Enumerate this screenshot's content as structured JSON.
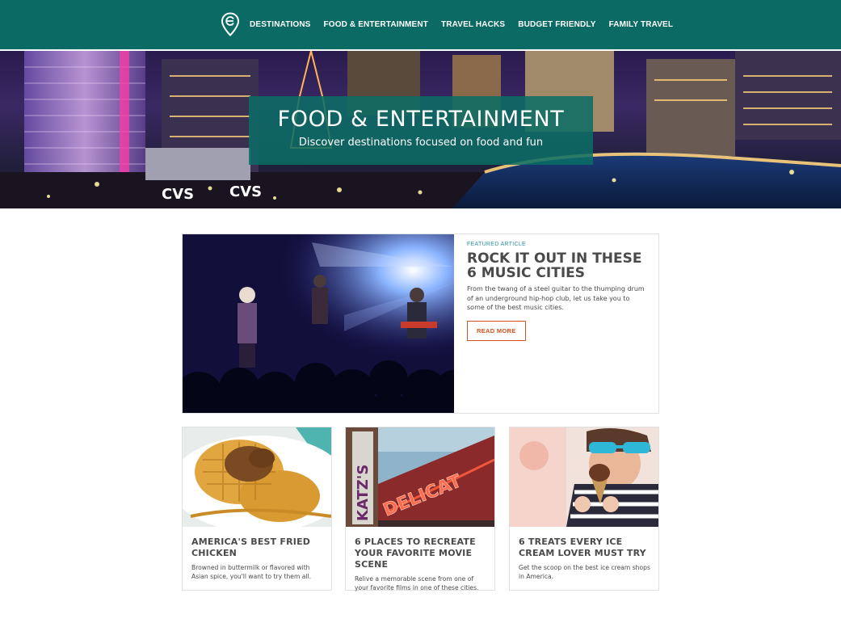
{
  "nav": {
    "logo_icon": "location-pin-icon",
    "links": [
      {
        "label": "DESTINATIONS"
      },
      {
        "label": "FOOD & ENTERTAINMENT"
      },
      {
        "label": "TRAVEL HACKS"
      },
      {
        "label": "BUDGET FRIENDLY"
      },
      {
        "label": "FAMILY TRAVEL"
      }
    ]
  },
  "hero": {
    "title": "FOOD & ENTERTAINMENT",
    "subtitle": "Discover destinations focused on food and fun",
    "sign_text": "CVS"
  },
  "featured": {
    "kicker": "FEATURED ARTICLE",
    "title": "ROCK IT OUT IN THESE 6 MUSIC CITIES",
    "text": "From the twang of a steel guitar to the thumping drum of an underground hip-hop club, let us take you to some of the best music cities.",
    "cta": "READ MORE"
  },
  "cards": [
    {
      "title": "AMERICA'S BEST FRIED CHICKEN",
      "text": "Browned in buttermilk or flavored with Asian spice, you'll want to try them all."
    },
    {
      "title": "6 PLACES TO RECREATE YOUR FAVORITE MOVIE SCENE",
      "text": "Relive a memorable scene from one of your favorite films in one of these cities.",
      "sign_vertical": "KATZ'S",
      "sign_horizontal": "DELICAT"
    },
    {
      "title": "6 TREATS EVERY ICE CREAM LOVER MUST TRY",
      "text": "Get the scoop on the best ice cream shops in America."
    }
  ],
  "colors": {
    "nav_bg": "#0b6a63",
    "hero_box": "#0a6e64",
    "accent_orange": "#d3531e",
    "kicker_blue": "#2c8fa3",
    "text_dark": "#4a4a4a"
  }
}
